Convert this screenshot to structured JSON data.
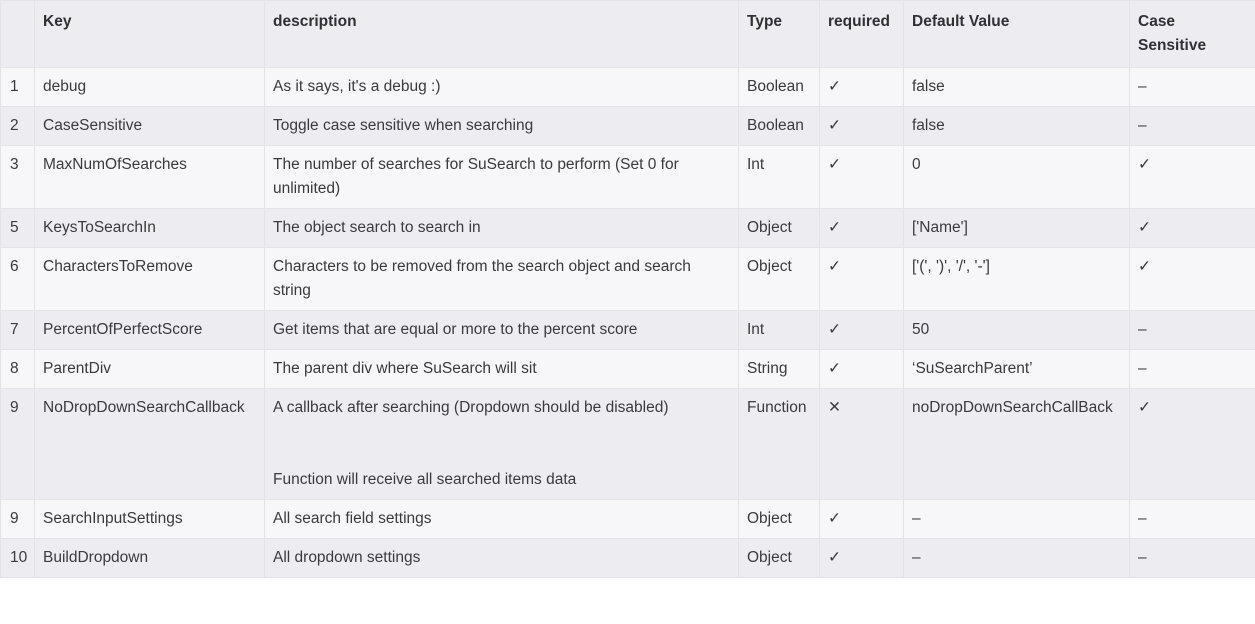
{
  "columns": [
    "",
    "Key",
    "description",
    "Type",
    "required",
    "Default Value",
    "Case Sensitive"
  ],
  "rows": [
    [
      "1",
      "debug",
      "As it says, it's a debug :)",
      "Boolean",
      "✓",
      "false",
      "–"
    ],
    [
      "2",
      "CaseSensitive",
      "Toggle case sensitive when searching",
      "Boolean",
      "✓",
      "false",
      "–"
    ],
    [
      "3",
      "MaxNumOfSearches",
      "The number of searches for SuSearch to perform (Set 0 for unlimited)",
      "Int",
      "✓",
      "0",
      "✓"
    ],
    [
      "5",
      "KeysToSearchIn",
      "The object search to search in",
      "Object",
      "✓",
      "['Name']",
      "✓"
    ],
    [
      "6",
      "CharactersToRemove",
      "Characters to be removed from the search object and search string",
      "Object",
      "✓",
      "['(', ')', '/', '-']",
      "✓"
    ],
    [
      "7",
      "PercentOfPerfectScore",
      "Get items that are equal or more to the percent score",
      "Int",
      "✓",
      "50",
      "–"
    ],
    [
      "8",
      "ParentDiv",
      "The parent div where SuSearch will sit",
      "String",
      "✓",
      "‘SuSearchParent’",
      "–"
    ],
    [
      "9",
      "NoDropDownSearchCallback",
      "A callback after searching (Dropdown should be disabled)\n\n\nFunction will receive all searched items data",
      "Function",
      "✕",
      "noDropDownSearchCallBack",
      "✓"
    ],
    [
      "9",
      "SearchInputSettings",
      "All search field settings",
      "Object",
      "✓",
      "–",
      "–"
    ],
    [
      "10",
      "BuildDropdown",
      "All dropdown settings",
      "Object",
      "✓",
      "–",
      "–"
    ]
  ]
}
